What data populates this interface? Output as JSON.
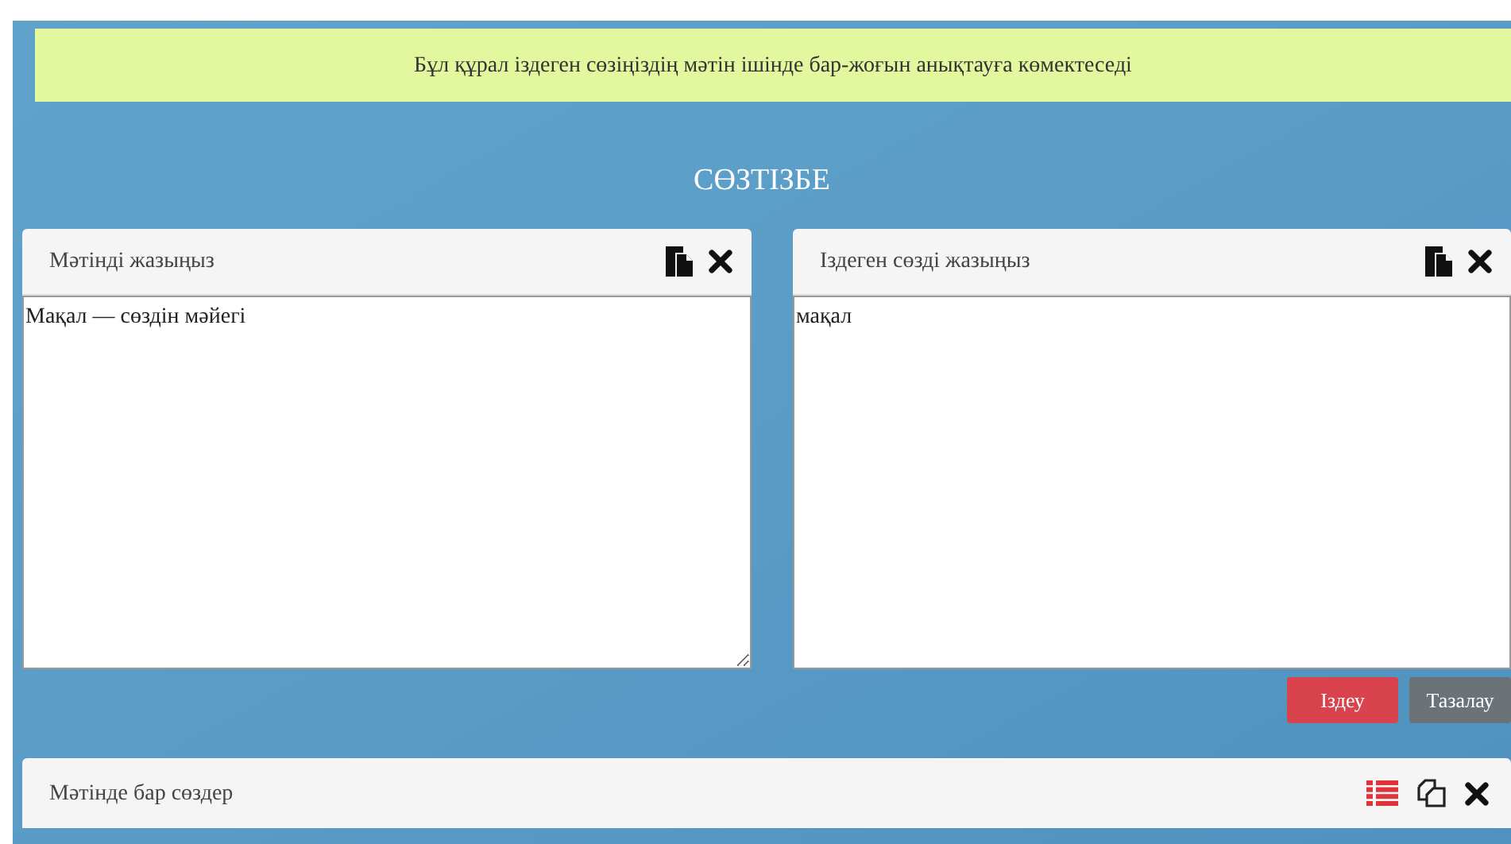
{
  "banner": {
    "text": "Бұл құрал іздеген сөзіңіздің мәтін ішінде бар-жоғын анықтауға көмектеседі"
  },
  "title": "СӨЗТІЗБЕ",
  "panels": [
    {
      "label": "Мәтінді жазыңыз",
      "value": "Мақал — сөздін мәйегі",
      "resizable": true
    },
    {
      "label": "Іздеген сөзді жазыңыз",
      "value": "мақал",
      "resizable": false
    }
  ],
  "buttons": [
    {
      "label": "Іздеу",
      "kind": "primary"
    },
    {
      "label": "Тазалау",
      "kind": "secondary"
    }
  ],
  "results": {
    "label": "Мәтінде бар сөздер"
  }
}
